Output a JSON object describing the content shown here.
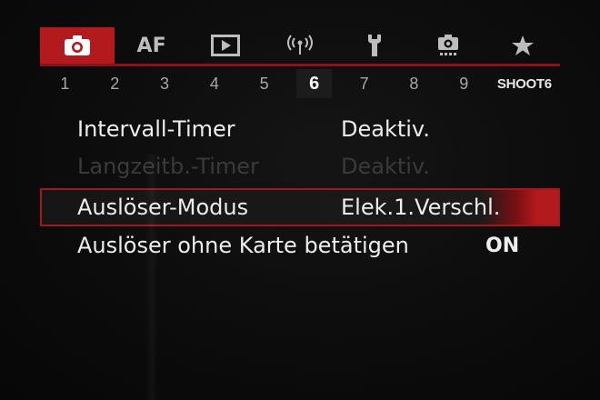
{
  "tabs": [
    {
      "name": "shooting",
      "icon": "camera-icon",
      "label": ""
    },
    {
      "name": "af",
      "icon": "",
      "label": "AF"
    },
    {
      "name": "playback",
      "icon": "play-icon",
      "label": ""
    },
    {
      "name": "wireless",
      "icon": "wireless-icon",
      "label": ""
    },
    {
      "name": "setup",
      "icon": "wrench-icon",
      "label": ""
    },
    {
      "name": "custom",
      "icon": "custom-camera-icon",
      "label": ""
    },
    {
      "name": "my-menu",
      "icon": "star-icon",
      "label": ""
    }
  ],
  "active_tab": "shooting",
  "subtabs": [
    "1",
    "2",
    "3",
    "4",
    "5",
    "6",
    "7",
    "8",
    "9",
    "SHOOT6"
  ],
  "active_subtab": "6",
  "menu": {
    "items": [
      {
        "label": "Intervall-Timer",
        "value": "Deaktiv.",
        "state": "normal"
      },
      {
        "label": "Langzeitb.-Timer",
        "value": "Deaktiv.",
        "state": "disabled"
      },
      {
        "label": "Auslöser-Modus",
        "value": "Elek.1.Verschl.",
        "state": "selected"
      },
      {
        "label": "Auslöser ohne Karte betätigen",
        "value": "ON",
        "state": "normal"
      }
    ]
  },
  "colors": {
    "accent": "#b31a1e",
    "background": "#0c0c0c",
    "text": "#ededed",
    "disabled_text": "#3a3a3a"
  }
}
